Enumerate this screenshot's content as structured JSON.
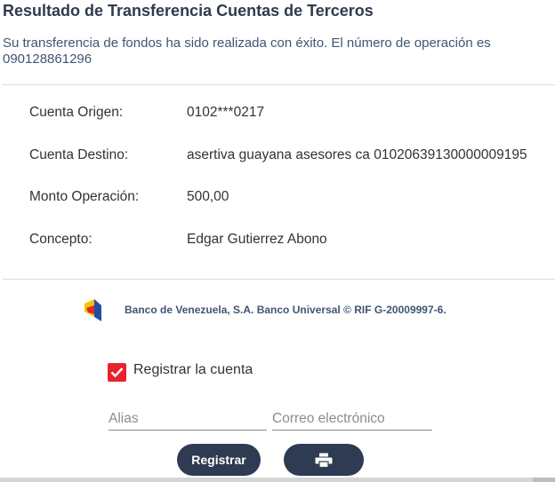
{
  "page": {
    "title": "Resultado de Transferencia Cuentas de Terceros",
    "message": "Su transferencia de fondos ha sido realizada con éxito. El número de operación es 090128861296"
  },
  "details": [
    {
      "label": "Cuenta Origen:",
      "value": "0102***0217"
    },
    {
      "label": "Cuenta Destino:",
      "value": "asertiva guayana asesores ca 01020639130000009195"
    },
    {
      "label": "Monto Operación:",
      "value": "500,00"
    },
    {
      "label": "Concepto:",
      "value": "Edgar Gutierrez Abono"
    }
  ],
  "footer": {
    "bank_text": "Banco de Venezuela, S.A. Banco Universal © RIF G-20009997-6.",
    "logo_icon": "bdv-logo-icon"
  },
  "register_account": {
    "checked": true,
    "label": "Registrar la cuenta",
    "alias_placeholder": "Alias",
    "alias_value": "",
    "email_placeholder": "Correo electrónico",
    "email_value": "",
    "register_button": "Registrar",
    "print_icon": "printer-icon"
  },
  "colors": {
    "title": "#2f3b4d",
    "message": "#3f5573",
    "button_bg": "#2f3b52",
    "checkbox": "#e8222e"
  }
}
